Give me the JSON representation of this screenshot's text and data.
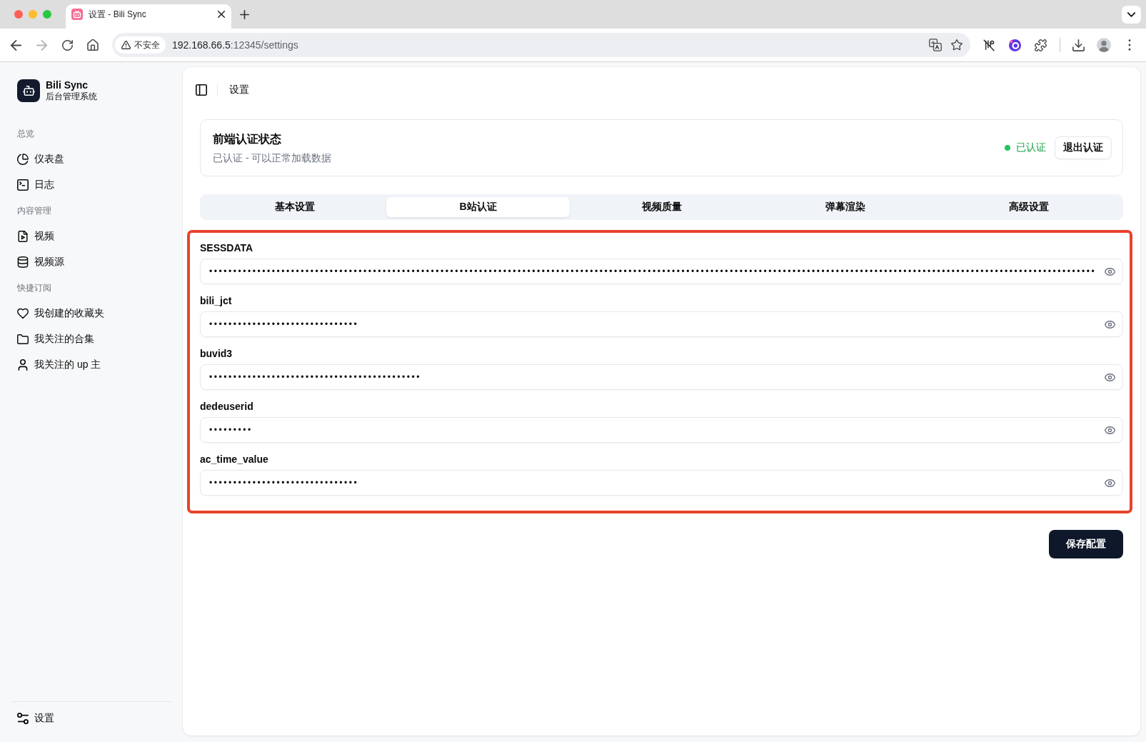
{
  "browser": {
    "tabs": [
      {
        "title": "设置 - Bili Sync",
        "selected": true
      }
    ],
    "back": {
      "disabled": false
    },
    "forward": {
      "disabled": true
    },
    "security_label": "不安全",
    "url": {
      "host": "192.168.66.5",
      "path": ":12345/settings"
    }
  },
  "sidebar": {
    "brand": {
      "name": "Bili Sync",
      "subtitle": "后台管理系统"
    },
    "groups": [
      {
        "label": "总览",
        "items": [
          {
            "label": "仪表盘",
            "selected": false
          },
          {
            "label": "日志",
            "selected": false
          }
        ]
      },
      {
        "label": "内容管理",
        "items": [
          {
            "label": "视频",
            "selected": false
          },
          {
            "label": "视频源",
            "selected": false
          }
        ]
      },
      {
        "label": "快捷订阅",
        "items": [
          {
            "label": "我创建的收藏夹",
            "selected": false
          },
          {
            "label": "我关注的合集",
            "selected": false
          },
          {
            "label": "我关注的 up 主",
            "selected": false
          }
        ]
      }
    ],
    "footer_items": [
      {
        "label": "设置",
        "selected": false
      }
    ]
  },
  "header": {
    "title": "设置"
  },
  "auth_card": {
    "title": "前端认证状态",
    "description": "已认证 - 可以正常加载数据",
    "status": {
      "label": "已认证",
      "authenticated": true
    },
    "button": "退出认证"
  },
  "settings_tabs": [
    {
      "label": "基本设置",
      "selected": false
    },
    {
      "label": "B站认证",
      "selected": true
    },
    {
      "label": "视频质量",
      "selected": false
    },
    {
      "label": "弹幕渲染",
      "selected": false
    },
    {
      "label": "高级设置",
      "selected": false
    }
  ],
  "credentials": {
    "highlighted": true,
    "fields": [
      {
        "label": "SESSDATA",
        "value": "••••••••••••••••••••••••••••••••••••••••••••••••••••••••••••••••••••••••••••••••••••••••••••••••••••••••••••••••••••••••••••••••••••••••••••••••••••••••••••••••••••••••••••••••••••••••"
      },
      {
        "label": "bili_jct",
        "value": "•••••••••••••••••••••••••••••••"
      },
      {
        "label": "buvid3",
        "value": "••••••••••••••••••••••••••••••••••••••••••••"
      },
      {
        "label": "dedeuserid",
        "value": "•••••••••"
      },
      {
        "label": "ac_time_value",
        "value": "•••••••••••••••••••••••••••••••"
      }
    ]
  },
  "save_button": "保存配置"
}
